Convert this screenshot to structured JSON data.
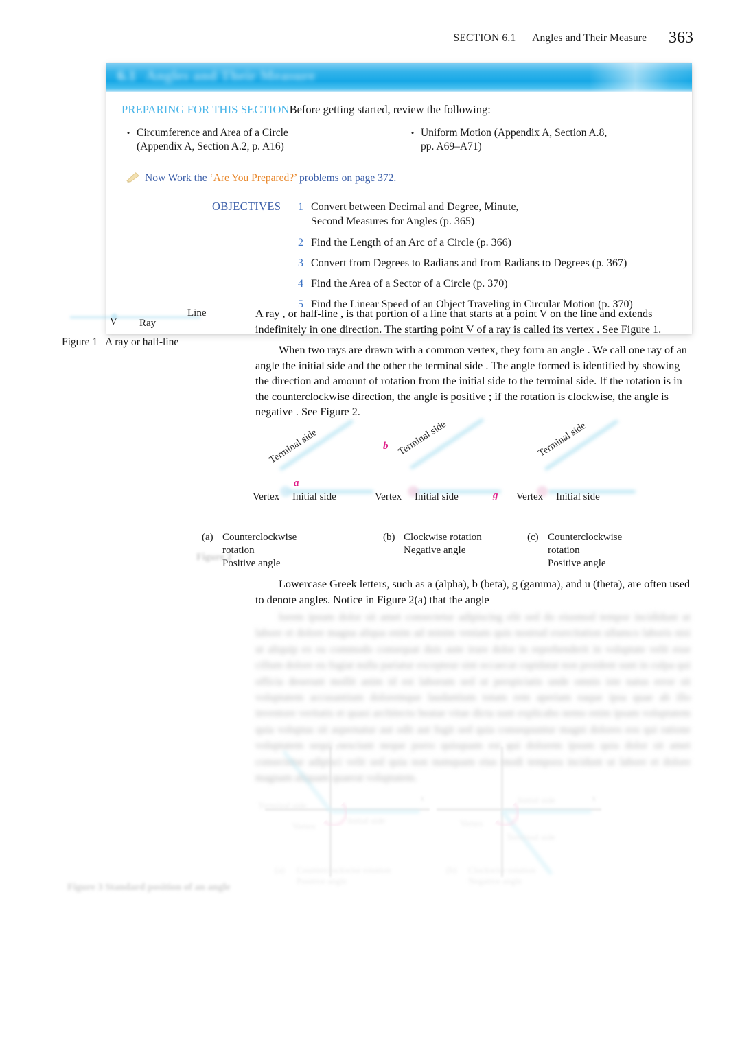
{
  "running_head": {
    "section": "SECTION 6.1",
    "title": "Angles and Their Measure",
    "page_number": "363"
  },
  "section_bar": {
    "number": "6.1",
    "title": "Angles and Their Measure",
    "accent_color": "#17a8e6"
  },
  "preparing": {
    "label": "PREPARING FOR THIS SECTION",
    "lead": "Before getting started, review the following:",
    "items_left": [
      {
        "bullet": "•",
        "line1": "Circumference and Area of a Circle",
        "line2": "(Appendix A, Section A.2, p. A16)"
      }
    ],
    "items_right": [
      {
        "bullet": "•",
        "line1": "Uniform Motion (Appendix A, Section A.8,",
        "line2": "pp. A69–A71)"
      }
    ]
  },
  "now_work": {
    "icon": "pencil-icon",
    "prefix": "Now Work the",
    "highlight": "‘Are You Prepared?’",
    "suffix": "problems on page 372.",
    "highlight_color": "#e8872b",
    "text_color": "#3b5ea8"
  },
  "objectives": {
    "label": "OBJECTIVES",
    "items": [
      {
        "number": "1",
        "text": "Convert between Decimal and Degree, Minute,",
        "text2": "Second Measures for Angles (p. 365)"
      },
      {
        "number": "2",
        "text": "Find the Length of an Arc of a Circle (p. 366)",
        "text2": ""
      },
      {
        "number": "3",
        "text": "Convert from Degrees to Radians and from Radians to Degrees (p. 367)",
        "text2": ""
      },
      {
        "number": "4",
        "text": "Find the Area of a Sector of a Circle (p. 370)",
        "text2": ""
      },
      {
        "number": "5",
        "text": "Find the Linear Speed of an Object Traveling in Circular Motion (p. 370)",
        "text2": ""
      }
    ]
  },
  "figure1": {
    "caption_number": "Figure 1",
    "caption_text": "A ray or half-line",
    "label_vertex": "V",
    "label_ray": "Ray",
    "label_line": "Line"
  },
  "body": {
    "paragraph1": "A  ray , or half-line , is that portion of a line that starts at a point        V on the line and extends indefinitely in one direction. The starting point        V of a ray is called its  vertex . See Figure 1.",
    "paragraph2": "When two rays are drawn with a common vertex, they  form  an          angle . We call one ray of an angle the    initial side  and the other the    terminal side  . The angle formed is identified by showing  the  direction  and  amount  of  rotation  from  the  initial  side to the terminal side. If the rotation is in the counterclockwise direction, the angle is positive ; if the rotation is clockwise, the angle is    negative . See Figure 2.",
    "paragraph3": "Lowercase Greek letters, such as      a  (alpha),  b  (beta),  g  (gamma), and   u  (theta), are  often  used  to  denote  angles.  Notice  in  Figure  2(a)  that  the  angle",
    "blurred_paragraph": "lorem ipsum dolor sit amet consectetur adipiscing elit sed do eiusmod tempor incididunt ut labore et dolore magna aliqua enim ad minim veniam quis nostrud exercitation ullamco laboris nisi ut aliquip ex ea commodo consequat duis aute irure dolor in reprehenderit in voluptate velit esse cillum dolore eu fugiat nulla pariatur excepteur sint occaecat cupidatat non proident sunt in culpa qui officia deserunt mollit anim id est laborum sed ut perspiciatis unde omnis iste natus error sit voluptatem accusantium doloremque laudantium totam rem aperiam eaque ipsa quae ab illo inventore veritatis et quasi architecto beatae vitae dicta sunt explicabo nemo enim ipsam voluptatem quia voluptas sit aspernatur aut odit aut fugit sed quia consequuntur magni dolores eos qui ratione voluptatem sequi nesciunt neque porro quisquam est qui dolorem ipsum quia dolor sit amet consectetur adipisci velit sed quia non numquam eius modi tempora incidunt ut labore et dolore magnam aliquam quaerat voluptatem."
  },
  "figure2": {
    "label": "Figure 2",
    "greek_color": "#e0218a",
    "ray_color": "#a9dff0",
    "panels": [
      {
        "greek": "a",
        "terminal_label": "Terminal side",
        "initial_label": "Initial side",
        "vertex_label": "Vertex",
        "caption_letter": "(a)",
        "caption_line1": "Counterclockwise",
        "caption_line2": "rotation",
        "caption_line3": "Positive angle"
      },
      {
        "greek": "b",
        "terminal_label": "Terminal side",
        "initial_label": "Initial side",
        "vertex_label": "Vertex",
        "caption_letter": "(b)",
        "caption_line1": "Clockwise rotation",
        "caption_line2": "Negative angle",
        "caption_line3": ""
      },
      {
        "greek": "g",
        "terminal_label": "Terminal side",
        "initial_label": "Initial side",
        "vertex_label": "Vertex",
        "caption_letter": "(c)",
        "caption_line1": "Counterclockwise",
        "caption_line2": "rotation",
        "caption_line3": "Positive angle"
      }
    ]
  },
  "figure3": {
    "label": "Figure 3",
    "title": "Standard position of an angle",
    "panels": [
      {
        "y_label": "y",
        "x_label": "x",
        "terminal_label": "Terminal side",
        "initial_label": "Initial side",
        "vertex_label": "Vertex",
        "caption_letter": "(a)",
        "caption_line1": "Counterclockwise rotation",
        "caption_line2": "Positive angle"
      },
      {
        "y_label": "y",
        "x_label": "x",
        "terminal_label": "Terminal side",
        "initial_label": "Initial side",
        "vertex_label": "Vertex",
        "caption_letter": "(b)",
        "caption_line1": "Clockwise rotation",
        "caption_line2": "Negative angle"
      }
    ]
  }
}
